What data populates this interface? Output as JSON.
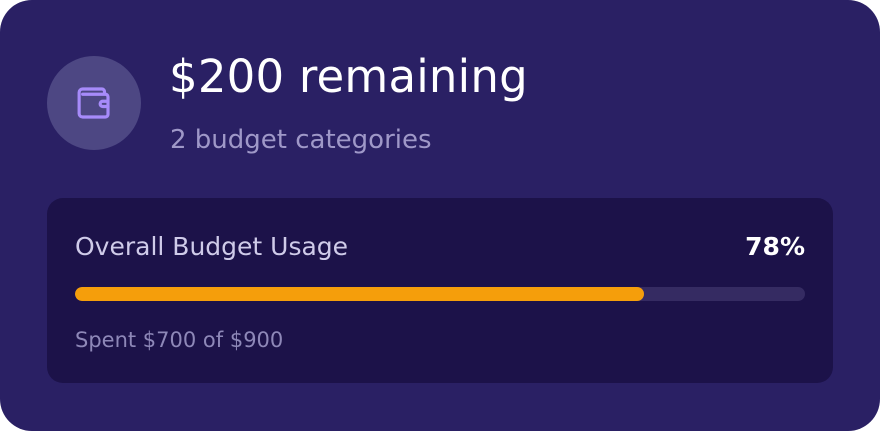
{
  "colors": {
    "card_bg": "#2a2064",
    "panel_bg": "#1c1249",
    "icon_circle_bg": "#4d4783",
    "icon_color": "#a78bfa",
    "progress_fill": "#f59e0b",
    "progress_track": "#352b62"
  },
  "header": {
    "icon": "wallet-icon",
    "title": "$200 remaining",
    "subtitle": "2 budget categories"
  },
  "usage": {
    "label": "Overall Budget Usage",
    "percent_text": "78%",
    "progress_fraction": 0.78,
    "spent_text": "Spent $700 of $900"
  }
}
